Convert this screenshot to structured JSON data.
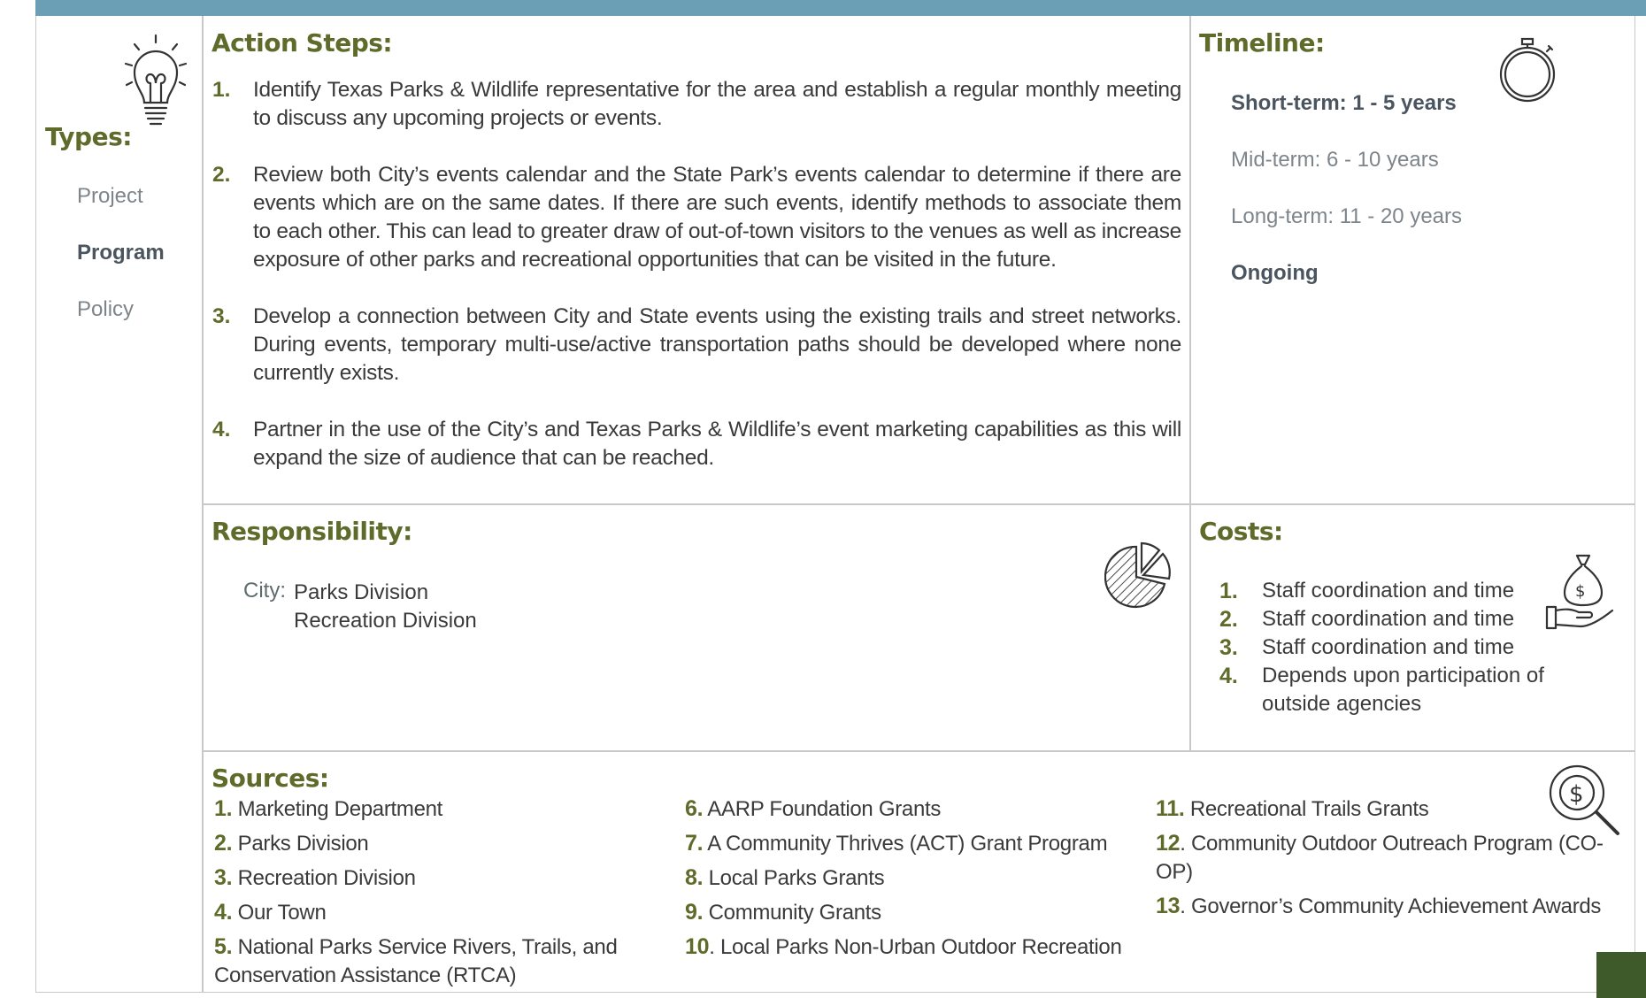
{
  "types": {
    "heading": "Types:",
    "items": [
      {
        "label": "Project",
        "selected": false
      },
      {
        "label": "Program",
        "selected": true
      },
      {
        "label": "Policy",
        "selected": false
      }
    ]
  },
  "action_steps": {
    "heading": "Action Steps:",
    "items": [
      {
        "num": "1.",
        "text": "Identify Texas Parks & Wildlife representative for the area and establish a regular monthly meeting to discuss any upcoming projects or events."
      },
      {
        "num": "2.",
        "text": "Review both City’s events calendar and the State Park’s events calendar to determine if there are events which are on the same dates. If there are such events, identify methods to associate them to each other. This can lead to greater draw of out-of-town visitors to the venues as well as increase exposure of other parks and recreational opportunities that can be visited in the future."
      },
      {
        "num": "3.",
        "text": "Develop a connection between City and State events using the existing trails and street networks. During events, temporary multi-use/active transportation paths should be developed where none currently exists."
      },
      {
        "num": "4.",
        "text": "Partner in the use of the City’s and Texas Parks & Wildlife’s event marketing capabilities as this will expand the size of audience that can be reached."
      }
    ]
  },
  "timeline": {
    "heading": "Timeline:",
    "items": [
      {
        "label": "Short-term:  1 - 5 years",
        "selected": true
      },
      {
        "label": "Mid-term:  6 - 10 years",
        "selected": false
      },
      {
        "label": "Long-term:  11 - 20 years",
        "selected": false
      },
      {
        "label": "Ongoing",
        "selected": true
      }
    ]
  },
  "responsibility": {
    "heading": "Responsibility:",
    "label": "City:",
    "values": [
      "Parks Division",
      "Recreation Division"
    ]
  },
  "costs": {
    "heading": "Costs:",
    "items": [
      {
        "num": "1.",
        "text": "Staff coordination and time"
      },
      {
        "num": "2.",
        "text": "Staff coordination and time"
      },
      {
        "num": "3.",
        "text": "Staff coordination and time"
      },
      {
        "num": "4.",
        "text": "Depends upon participation of outside agencies"
      }
    ]
  },
  "sources": {
    "heading": "Sources:",
    "col1": [
      {
        "num": "1.",
        "text": " Marketing Department"
      },
      {
        "num": "2.",
        "text": " Parks Division"
      },
      {
        "num": "3.",
        "text": " Recreation Division"
      },
      {
        "num": "4.",
        "text": " Our Town"
      },
      {
        "num": "5.",
        "text": " National Parks Service Rivers, Trails, and Conservation Assistance (RTCA)"
      }
    ],
    "col2": [
      {
        "num": "6.",
        "text": " AARP Foundation Grants"
      },
      {
        "num": "7.",
        "text": " A Community Thrives (ACT) Grant Program"
      },
      {
        "num": "8.",
        "text": " Local Parks Grants"
      },
      {
        "num": "9.",
        "text": " Community Grants"
      },
      {
        "num": "10",
        "text": ". Local Parks Non-Urban Outdoor Recreation"
      }
    ],
    "col3": [
      {
        "num": "11.",
        "text": " Recreational Trails Grants"
      },
      {
        "num": "12",
        "text": ". Community Outdoor Outreach Program (CO-OP)"
      },
      {
        "num": "13",
        "text": ". Governor’s Community Achievement Awards"
      }
    ]
  },
  "icons": [
    "lightbulb-icon",
    "stopwatch-icon",
    "pie-chart-icon",
    "money-bag-hand-icon",
    "dollar-search-icon"
  ],
  "colors": {
    "accent_bar": "#6a9fb5",
    "heading_green": "#5f6b2a",
    "text_gray": "#7d858b"
  }
}
